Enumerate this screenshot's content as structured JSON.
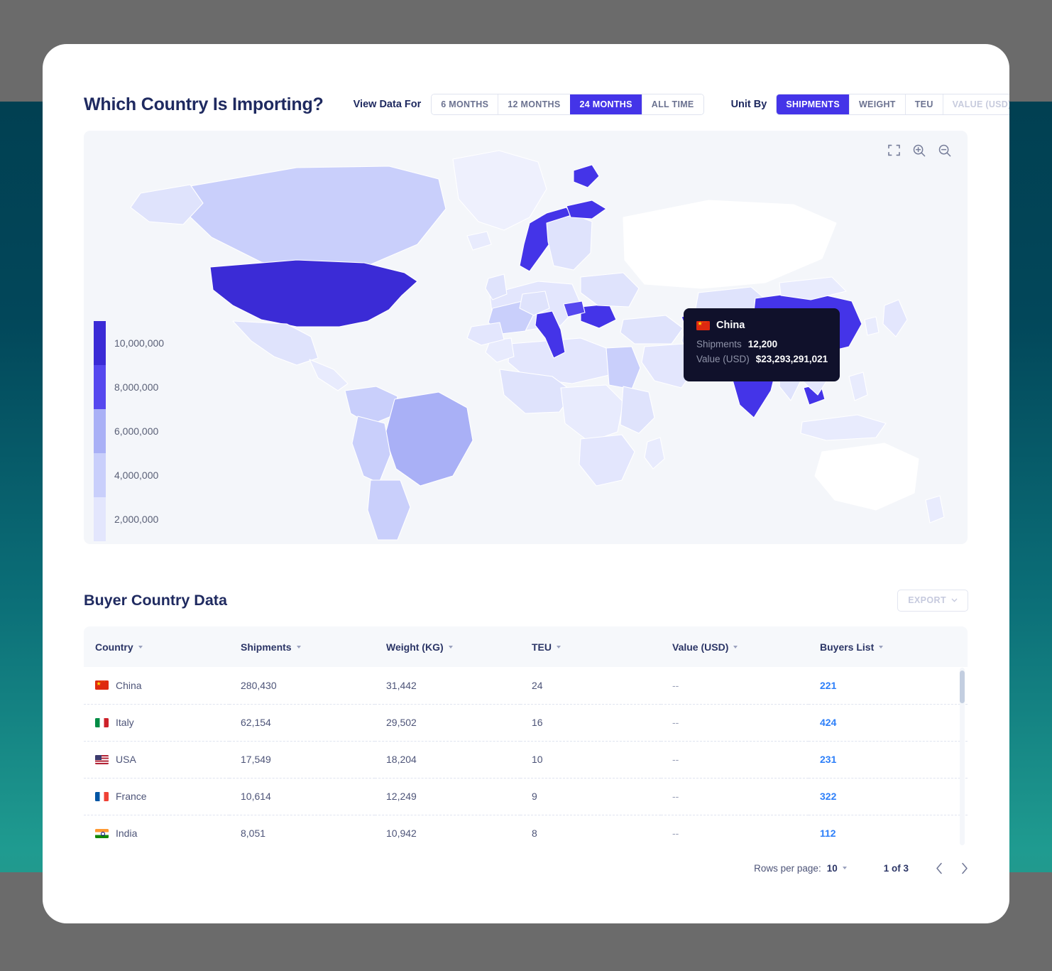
{
  "header": {
    "title": "Which Country Is Importing?",
    "view_data_for_label": "View Data For",
    "period_options": [
      {
        "label": "6 MONTHS",
        "active": false,
        "disabled": false
      },
      {
        "label": "12 MONTHS",
        "active": false,
        "disabled": false
      },
      {
        "label": "24 MONTHS",
        "active": true,
        "disabled": false
      },
      {
        "label": "ALL TIME",
        "active": false,
        "disabled": false
      }
    ],
    "unit_by_label": "Unit By",
    "unit_options": [
      {
        "label": "SHIPMENTS",
        "active": true,
        "disabled": false
      },
      {
        "label": "WEIGHT",
        "active": false,
        "disabled": false
      },
      {
        "label": "TEU",
        "active": false,
        "disabled": false
      },
      {
        "label": "VALUE (USD)",
        "active": false,
        "disabled": true
      }
    ]
  },
  "map": {
    "tools": [
      "fullscreen-icon",
      "zoom-in-icon",
      "zoom-out-icon"
    ],
    "legend": [
      {
        "value": "10,000,000",
        "color": "#3b2bd6"
      },
      {
        "value": "8,000,000",
        "color": "#5648ef"
      },
      {
        "value": "6,000,000",
        "color": "#a9b0f6"
      },
      {
        "value": "4,000,000",
        "color": "#c9cffb"
      },
      {
        "value": "2,000,000",
        "color": "#e3e6fd"
      }
    ],
    "tooltip": {
      "country": "China",
      "flag": "flag-cn",
      "rows": [
        {
          "key": "Shipments",
          "value": "12,200"
        },
        {
          "key": "Value (USD)",
          "value": "$23,293,291,021"
        }
      ]
    }
  },
  "table_section": {
    "title": "Buyer Country Data",
    "export_label": "EXPORT",
    "columns": [
      "Country",
      "Shipments",
      "Weight (KG)",
      "TEU",
      "Value (USD)",
      "Buyers List"
    ],
    "rows": [
      {
        "flag": "flag-cn",
        "country": "China",
        "shipments": "280,430",
        "weight": "31,442",
        "teu": "24",
        "value": "--",
        "buyers": "221"
      },
      {
        "flag": "flag-it",
        "country": "Italy",
        "shipments": "62,154",
        "weight": "29,502",
        "teu": "16",
        "value": "--",
        "buyers": "424"
      },
      {
        "flag": "flag-us",
        "country": "USA",
        "shipments": "17,549",
        "weight": "18,204",
        "teu": "10",
        "value": "--",
        "buyers": "231"
      },
      {
        "flag": "flag-fr",
        "country": "France",
        "shipments": "10,614",
        "weight": "12,249",
        "teu": "9",
        "value": "--",
        "buyers": "322"
      },
      {
        "flag": "flag-in",
        "country": "India",
        "shipments": "8,051",
        "weight": "10,942",
        "teu": "8",
        "value": "--",
        "buyers": "112"
      }
    ],
    "pagination": {
      "rows_per_page_label": "Rows per page:",
      "rows_per_page_value": "10",
      "page_indicator": "1 of 3"
    }
  },
  "chart_data": {
    "type": "heatmap",
    "title": "Which Country Is Importing?",
    "subtitle": "Buyer Country Data",
    "unit": "Shipments",
    "period": "24 MONTHS",
    "legend_position": "left",
    "scale_label": "Shipments",
    "scale_stops": [
      2000000,
      4000000,
      6000000,
      8000000,
      10000000
    ],
    "scale_colors": [
      "#e3e6fd",
      "#c9cffb",
      "#a9b0f6",
      "#5648ef",
      "#3b2bd6"
    ],
    "highlighted": {
      "country": "China",
      "shipments": 12200,
      "value_usd": 23293291021
    },
    "categories": [
      "China",
      "Italy",
      "USA",
      "France",
      "India"
    ],
    "series": [
      {
        "name": "Shipments",
        "values": [
          280430,
          62154,
          17549,
          10614,
          8051
        ]
      },
      {
        "name": "Weight (KG)",
        "values": [
          31442,
          29502,
          18204,
          12249,
          10942
        ]
      },
      {
        "name": "TEU",
        "values": [
          24,
          16,
          10,
          9,
          8
        ]
      },
      {
        "name": "Buyers List",
        "values": [
          221,
          424,
          231,
          322,
          112
        ]
      }
    ],
    "country_shades": {
      "USA": "#3b2bd6",
      "China": "#5648ef",
      "India": "#5648ef",
      "Pakistan": "#5648ef",
      "Italy": "#5648ef",
      "Norway": "#5648ef",
      "Romania": "#5648ef",
      "Greenland-east": "#5648ef",
      "Cambodia": "#5648ef",
      "Canada": "#c9cffb",
      "Brazil": "#a9b0f6",
      "Australia": "#ffffff",
      "Russia": "#ffffff"
    }
  }
}
